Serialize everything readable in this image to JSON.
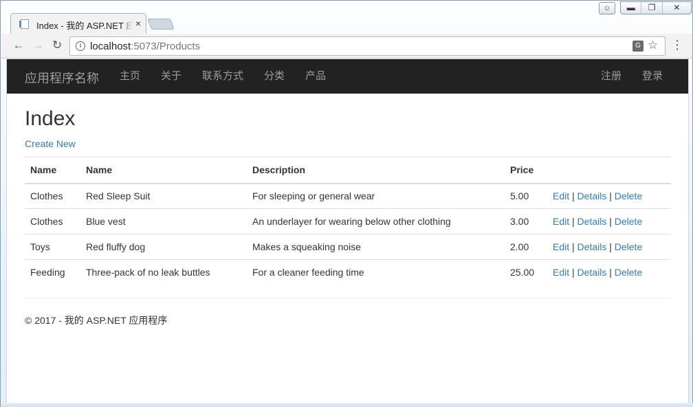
{
  "browser": {
    "tab_title": "Index - 我的 ASP.NET 应",
    "tab_close": "×",
    "url_host": "localhost",
    "url_rest": ":5073/Products"
  },
  "navbar": {
    "brand": "应用程序名称",
    "left_items": [
      "主页",
      "关于",
      "联系方式",
      "分类",
      "产品"
    ],
    "right_items": [
      "注册",
      "登录"
    ]
  },
  "main": {
    "title": "Index",
    "create_link": "Create New",
    "table": {
      "headers": [
        "Name",
        "Name",
        "Description",
        "Price",
        ""
      ],
      "rows": [
        {
          "category": "Clothes",
          "name": "Red Sleep Suit",
          "description": "For sleeping or general wear",
          "price": "5.00"
        },
        {
          "category": "Clothes",
          "name": "Blue vest",
          "description": "An underlayer for wearing below other clothing",
          "price": "3.00"
        },
        {
          "category": "Toys",
          "name": "Red fluffy dog",
          "description": "Makes a squeaking noise",
          "price": "2.00"
        },
        {
          "category": "Feeding",
          "name": "Three-pack of no leak buttles",
          "description": "For a cleaner feeding time",
          "price": "25.00"
        }
      ],
      "actions": {
        "edit": "Edit",
        "details": "Details",
        "delete": "Delete",
        "separator": "|"
      }
    }
  },
  "footer": {
    "text": "© 2017 - 我的 ASP.NET 应用程序"
  },
  "colors": {
    "navbar_bg": "#222222",
    "link": "#337ab7",
    "navbar_text": "#9d9d9d"
  }
}
